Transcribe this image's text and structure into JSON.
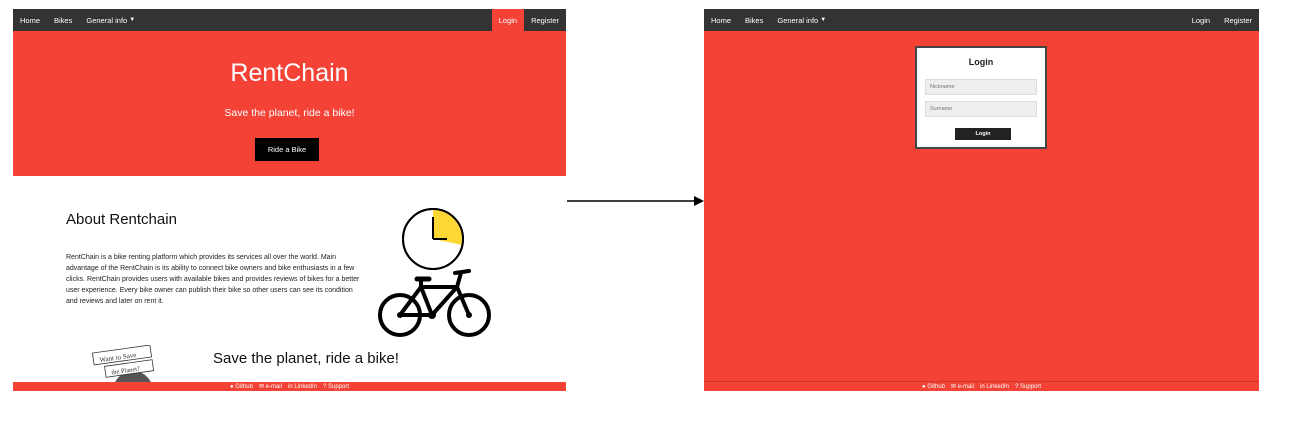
{
  "nav": {
    "home": "Home",
    "bikes": "Bikes",
    "general_info": "General info",
    "login": "Login",
    "register": "Register"
  },
  "hero": {
    "title": "RentChain",
    "subtitle": "Save the planet, ride a bike!",
    "button": "Ride a Bike"
  },
  "about": {
    "title": "About Rentchain",
    "text": "RentChain is a bike renting platform which provides its services all over the world. Main advantage of the RentChain is its ability to connect bike owners and bike enthusiasts in a few clicks. RentChain provides users with available bikes and provides reviews of bikes for a better user experience. Every bike owner can publish their bike so other users can see its condition and reviews and later on rent it."
  },
  "badge": {
    "line1": "Want to Save",
    "line2": "the Planet?"
  },
  "slogan": "Save the planet, ride a bike!",
  "footer": {
    "github": "Github",
    "email": "e-mail",
    "linkedin": "LinkedIn",
    "support": "Support"
  },
  "login_form": {
    "title": "Login",
    "nickname_placeholder": "Nickname",
    "surname_placeholder": "Surname",
    "button": "Login"
  },
  "colors": {
    "accent": "#f44336",
    "nav": "#333333",
    "clock_fill": "#fdd835"
  },
  "icons": [
    "caret-down-icon",
    "clock-icon",
    "bicycle-icon",
    "github-icon",
    "envelope-icon",
    "linkedin-icon",
    "question-icon",
    "arrow-right-icon"
  ]
}
